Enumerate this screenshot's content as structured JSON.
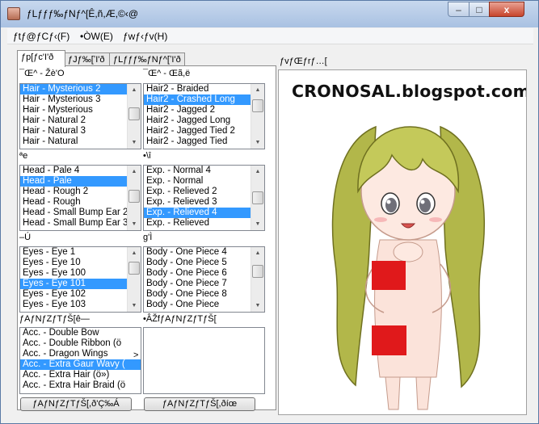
{
  "window": {
    "title": "ƒLƒƒƒ‰ƒNƒ^[Ȇ,ñ,Æ,©‹@",
    "controls": {
      "minimize": "–",
      "maximize": "□",
      "close": "x"
    }
  },
  "menu": [
    "ƒtƒ@ƒCƒ‹(F)",
    "•ÒW(E)",
    "ƒwƒ‹ƒv(H)"
  ],
  "tabs": [
    "ƒp[ƒc'I'ð",
    "ƒJƒ‰[ʼI'ð",
    "ƒLƒƒƒ‰ƒNƒ^[ʼI'ð"
  ],
  "groups": [
    {
      "label": "¯Œ^ - Žè'O",
      "items": [
        "Hair - Mysterious 2",
        "Hair - Mysterious 3",
        "Hair - Mysterious",
        "Hair - Natural 2",
        "Hair - Natural 3",
        "Hair - Natural"
      ],
      "selected": 0
    },
    {
      "label": "¯Œ^ - Œã,ë",
      "items": [
        "Hair2 - Braided",
        "Hair2 - Crashed Long",
        "Hair2 - Jagged 2",
        "Hair2 - Jagged Long",
        "Hair2 - Jagged Tied 2",
        "Hair2 - Jagged Tied"
      ],
      "selected": 1
    },
    {
      "label": "ªe",
      "items": [
        "Head - Pale 4",
        "Head - Pale",
        "Head - Rough 2",
        "Head - Rough",
        "Head - Small Bump Ear 2",
        "Head - Small Bump Ear 3"
      ],
      "selected": 1
    },
    {
      "label": "•\\î",
      "items": [
        "Exp. - Normal 4",
        "Exp. - Normal",
        "Exp. - Relieved 2",
        "Exp. - Relieved 3",
        "Exp. - Relieved 4",
        "Exp. - Relieved"
      ],
      "selected": 4
    },
    {
      "label": "–Ú",
      "items": [
        "Eyes - Eye 1",
        "Eyes - Eye 10",
        "Eyes - Eye 100",
        "Eyes - Eye 101",
        "Eyes - Eye 102",
        "Eyes - Eye 103"
      ],
      "selected": 3
    },
    {
      "label": "g'Ì",
      "items": [
        "Body - One Piece 4",
        "Body - One Piece 5",
        "Body - One Piece 6",
        "Body - One Piece 7",
        "Body - One Piece 8",
        "Body - One Piece"
      ],
      "selected": -1
    },
    {
      "label": "ƒAƒNƒZƒTƒŠ[ê—",
      "items": [
        "Acc. - Double Bow",
        "Acc. - Double Ribbon (ö",
        "Acc. - Dragon Wings",
        "Acc. - Extra Gaur Wavy (",
        "Acc. - Extra Hair (ö»)",
        "Acc. - Extra Hair Braid (ö"
      ],
      "selected": 3
    },
    {
      "label": "•ÂŽfƒAƒNƒZƒTƒŠ[",
      "items": [],
      "selected": -1
    }
  ],
  "buttons": {
    "add_accessory": "ƒAƒNƒZƒTƒŠ[,ð'Ç‰Á",
    "remove_accessory": "ƒAƒNƒZƒTƒŠ[,ðíœ",
    "move_right": ">"
  },
  "preview": {
    "label": "ƒvƒŒƒrƒ…[",
    "watermark": "CRONOSAL.blogspot.com"
  }
}
